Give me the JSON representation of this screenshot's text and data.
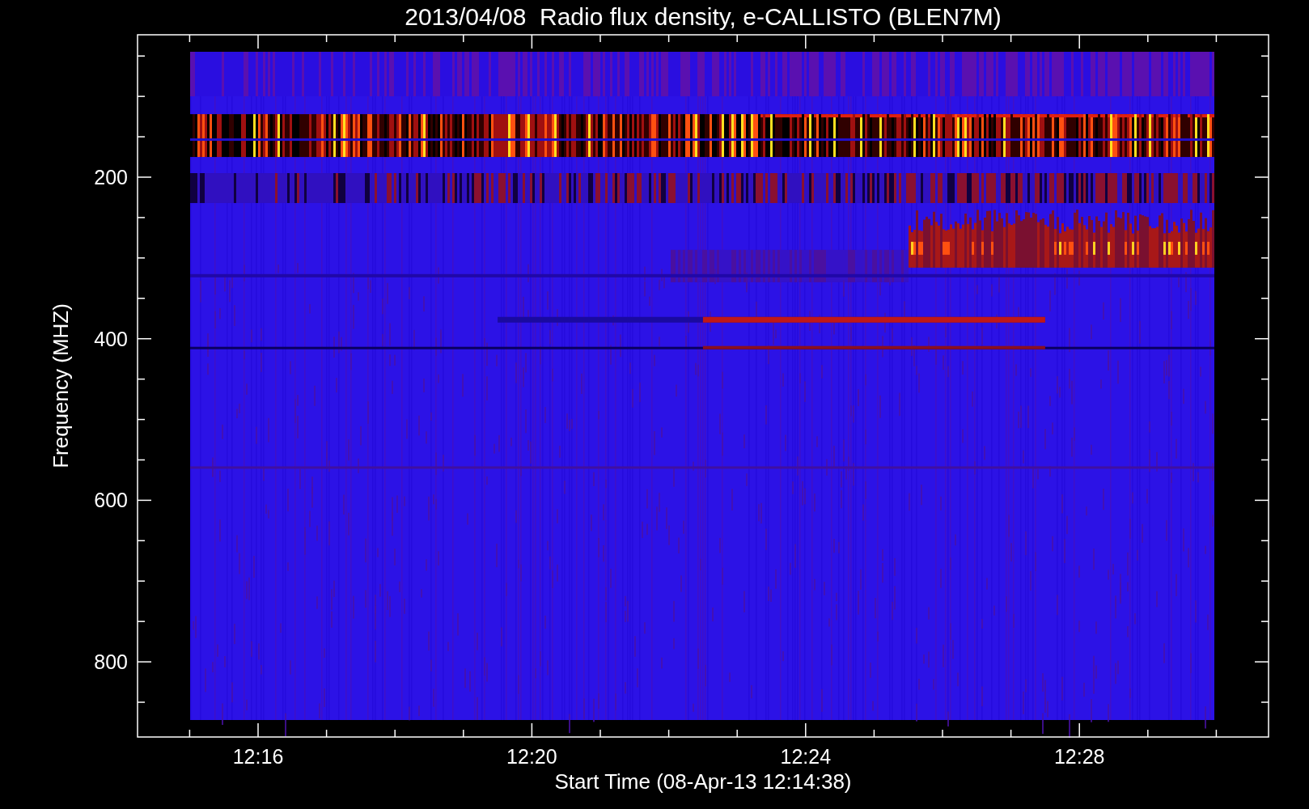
{
  "title": "2013/04/08  Radio flux density, e-CALLISTO (BLEN7M)",
  "y_axis": {
    "label": "Frequency (MHZ)",
    "ticks": [
      "200",
      "400",
      "600",
      "800"
    ]
  },
  "x_axis": {
    "label": "Start Time (08-Apr-13 12:14:38)",
    "ticks": [
      "12:16",
      "12:20",
      "12:24",
      "12:28"
    ]
  }
}
